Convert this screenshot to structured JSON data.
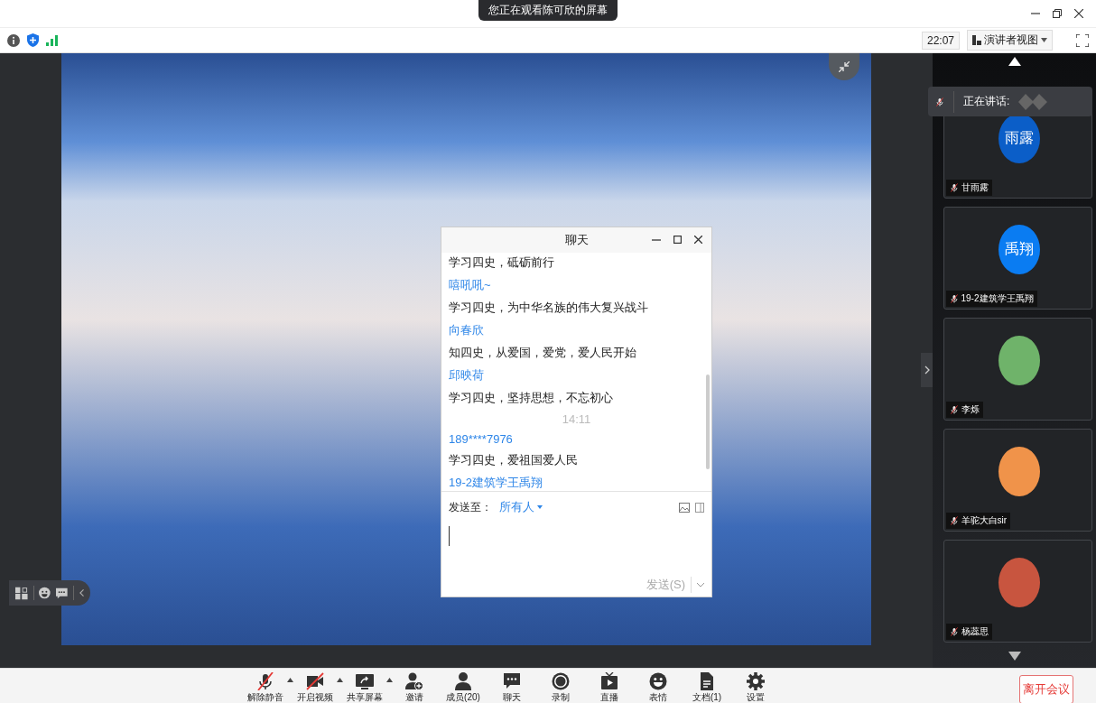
{
  "banner": {
    "text": "您正在观看陈可欣的屏幕"
  },
  "info_bar": {
    "time": "22:07",
    "view_button": "演讲者视图"
  },
  "speaking": {
    "label": "正在讲话:"
  },
  "participants": [
    {
      "name": "甘雨露",
      "kind": "initials",
      "avatar_text": "雨露",
      "color": "#0b5ec8",
      "muted": true
    },
    {
      "name": "19-2建筑学王禹翔",
      "kind": "initials",
      "avatar_text": "禹翔",
      "color": "#0a7cf2",
      "muted": true
    },
    {
      "name": "李烁",
      "kind": "photo",
      "color": "#6fb36a",
      "muted": true
    },
    {
      "name": "羊驼大白sir",
      "kind": "photo",
      "color": "#f0934a",
      "muted": true
    },
    {
      "name": "杨蕊思",
      "kind": "photo",
      "color": "#c8553f",
      "muted": true
    }
  ],
  "chat": {
    "title": "聊天",
    "messages": [
      {
        "kind": "message",
        "text": "学习四史，砥砺前行"
      },
      {
        "kind": "sender",
        "text": "嘻吼吼~"
      },
      {
        "kind": "message",
        "text": "学习四史，为中华名族的伟大复兴战斗"
      },
      {
        "kind": "sender",
        "text": "向春欣"
      },
      {
        "kind": "message",
        "text": "知四史，从爱国，爱党，爱人民开始"
      },
      {
        "kind": "sender",
        "text": "邱映荷"
      },
      {
        "kind": "message",
        "text": "学习四史，坚持思想，不忘初心"
      },
      {
        "kind": "time",
        "text": "14:11"
      },
      {
        "kind": "sender",
        "text": "189****7976"
      },
      {
        "kind": "message",
        "text": "学习四史，爱祖国爱人民"
      },
      {
        "kind": "sender",
        "text": "19-2建筑学王禹翔"
      }
    ],
    "send_to_label": "发送至：",
    "recipient": "所有人",
    "send_button": "发送(S)",
    "send_enabled": false
  },
  "toolbar": {
    "items": [
      {
        "kind": "mic",
        "label": "解除静音",
        "has_menu": true
      },
      {
        "kind": "video",
        "label": "开启视频",
        "has_menu": true
      },
      {
        "kind": "share",
        "label": "共享屏幕",
        "has_menu": true
      },
      {
        "kind": "invite",
        "label": "邀请",
        "has_menu": false
      },
      {
        "kind": "members",
        "label": "成员(20)",
        "has_menu": false
      },
      {
        "kind": "chat",
        "label": "聊天",
        "has_menu": false
      },
      {
        "kind": "record",
        "label": "录制",
        "has_menu": false
      },
      {
        "kind": "live",
        "label": "直播",
        "has_menu": false
      },
      {
        "kind": "emoji",
        "label": "表情",
        "has_menu": false
      },
      {
        "kind": "docs",
        "label": "文档(1)",
        "has_menu": false
      },
      {
        "kind": "settings",
        "label": "设置",
        "has_menu": false
      }
    ],
    "leave_button": "离开会议"
  }
}
